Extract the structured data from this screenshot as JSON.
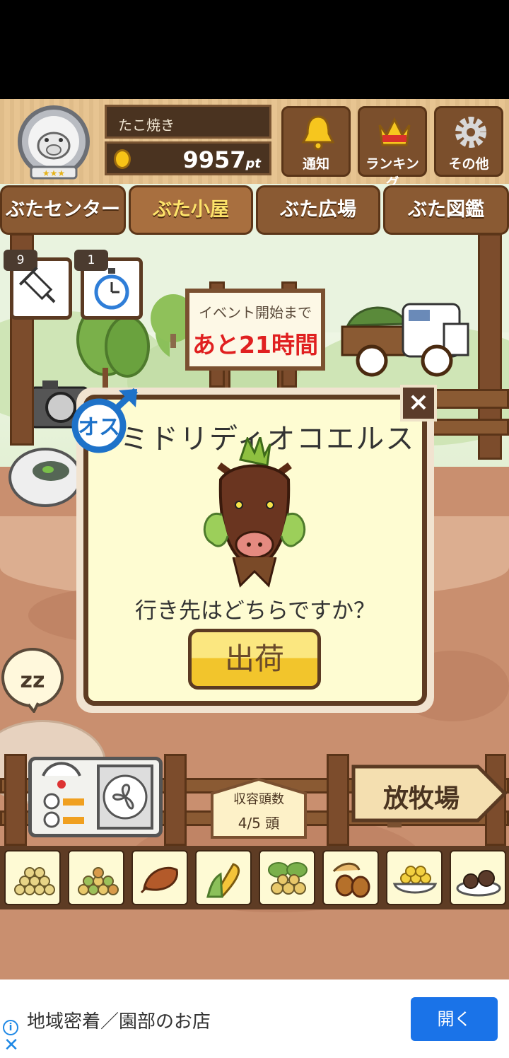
{
  "player": {
    "name": "たこ焼き",
    "points": "9957",
    "points_unit": "pt"
  },
  "header_buttons": [
    {
      "label": "通知",
      "icon": "bell-icon"
    },
    {
      "label": "ランキング",
      "icon": "crown-icon"
    },
    {
      "label": "その他",
      "icon": "gear-icon"
    }
  ],
  "tabs": [
    {
      "label": "ぶたセンター",
      "active": false
    },
    {
      "label": "ぶた小屋",
      "active": true
    },
    {
      "label": "ぶた広場",
      "active": false
    },
    {
      "label": "ぶた図鑑",
      "active": false
    }
  ],
  "items": [
    {
      "icon": "syringe-icon",
      "count": "9"
    },
    {
      "icon": "stopwatch-icon",
      "count": "1"
    }
  ],
  "event_sign": {
    "line1": "イベント開始まで",
    "line2": "あと21時間"
  },
  "dialog": {
    "sex_label": "オス",
    "pig_name": "ミドリディオコエルス",
    "question": "行き先はどちらですか？",
    "ship_button": "出荷",
    "close": "×"
  },
  "capacity": {
    "label": "収容頭数",
    "value": "4/5 頭"
  },
  "pasture_sign": "放牧場",
  "food_items": [
    "soybeans-icon",
    "mixed-beans-icon",
    "sweet-potato-icon",
    "corn-icon",
    "herb-seeds-icon",
    "acorns-icon",
    "grain-bowl-icon",
    "truffles-icon"
  ],
  "ad": {
    "text": "地域密着／園部のお店",
    "button": "開く"
  },
  "colors": {
    "wood_dark": "#5b3a22",
    "dialog_bg": "#fefcd2",
    "button_yellow": "#f2c52c",
    "ad_blue": "#1a73e8",
    "countdown_red": "#e02020"
  }
}
